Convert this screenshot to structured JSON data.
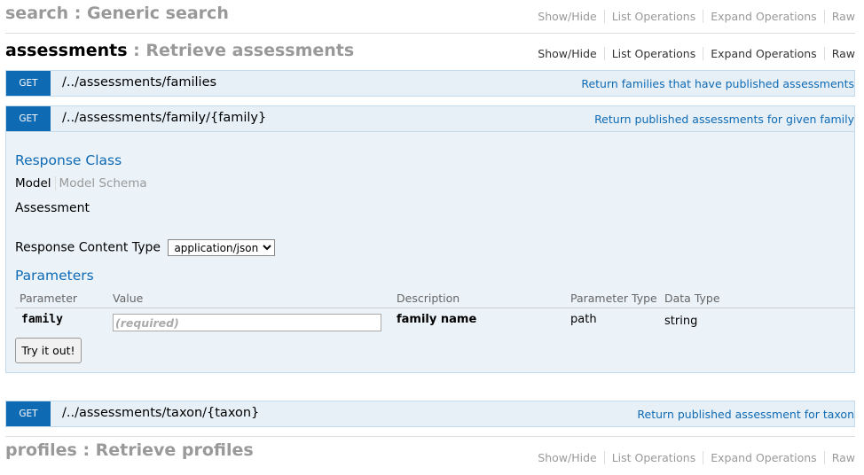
{
  "resources": {
    "search": {
      "name": "search",
      "separator": " : ",
      "description": "Generic search"
    },
    "assessments": {
      "name": "assessments",
      "separator": " : ",
      "description": "Retrieve assessments"
    },
    "profiles": {
      "name": "profiles",
      "separator": " : ",
      "description": "Retrieve profiles"
    }
  },
  "options": {
    "show_hide": "Show/Hide",
    "list_operations": "List Operations",
    "expand_operations": "Expand Operations",
    "raw": "Raw"
  },
  "operations": [
    {
      "verb": "GET",
      "path": "/../assessments/families",
      "summary": "Return families that have published assessments"
    },
    {
      "verb": "GET",
      "path": "/../assessments/family/{family}",
      "summary": "Return published assessments for given family"
    },
    {
      "verb": "GET",
      "path": "/../assessments/taxon/{taxon}",
      "summary": "Return published assessment for taxon"
    }
  ],
  "expanded": {
    "response_class_title": "Response Class",
    "model_tab": "Model",
    "model_schema_tab": "Model Schema",
    "model_name": "Assessment",
    "content_type_label": "Response Content Type",
    "content_type_value": "application/json",
    "parameters_title": "Parameters",
    "param_headers": {
      "parameter": "Parameter",
      "value": "Value",
      "description": "Description",
      "parameter_type": "Parameter Type",
      "data_type": "Data Type"
    },
    "param": {
      "name": "family",
      "placeholder": "(required)",
      "description": "family name",
      "parameter_type": "path",
      "data_type": "string"
    },
    "try_button": "Try it out!"
  },
  "colors": {
    "verb_get": "#0f6ab4",
    "op_bg": "#e7f0f7",
    "link": "#0f6ab4"
  }
}
